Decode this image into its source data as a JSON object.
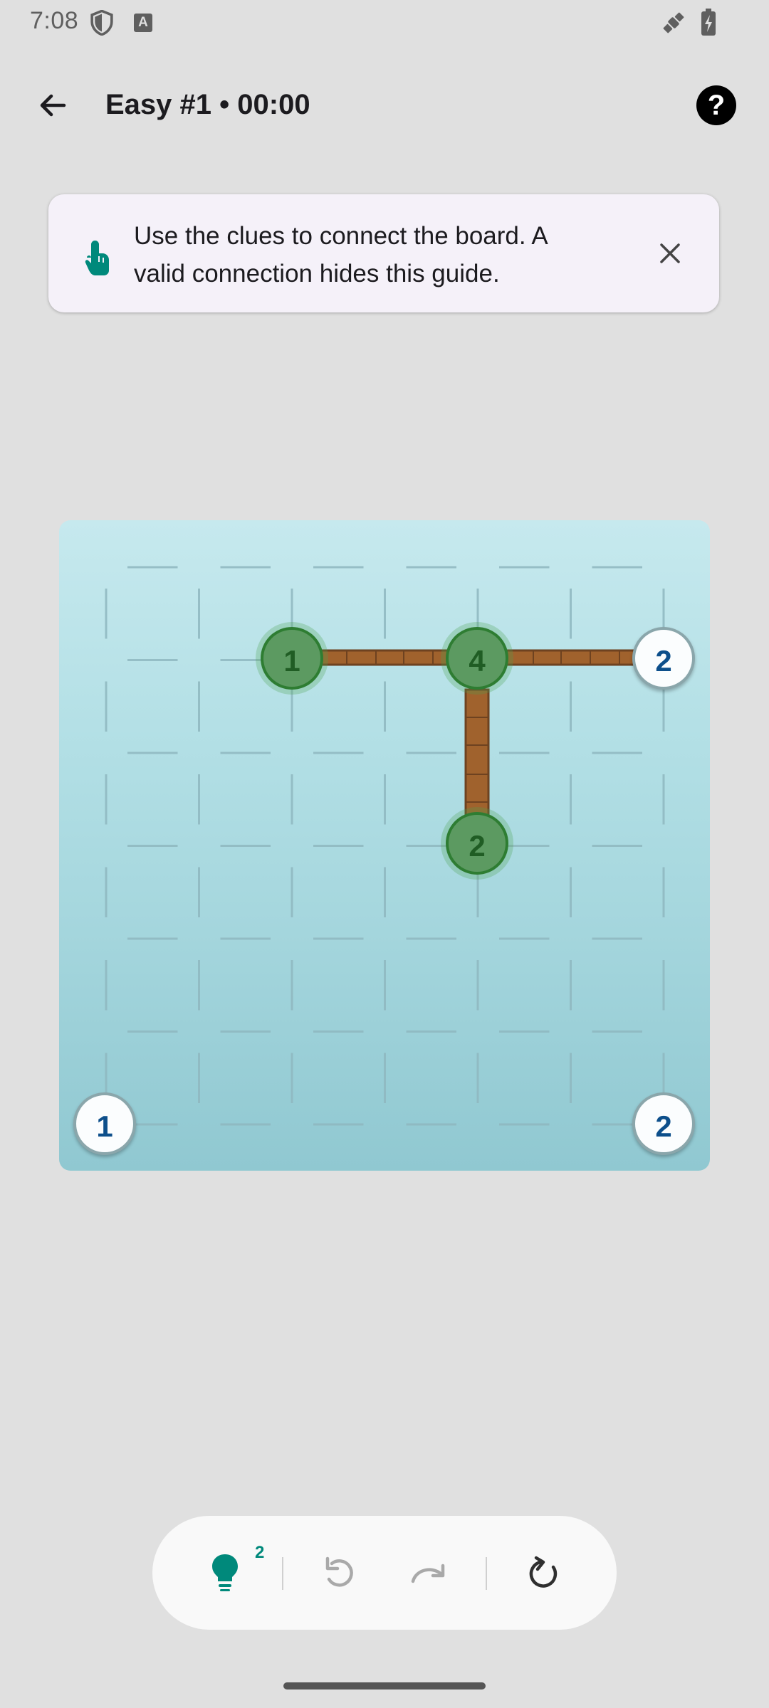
{
  "status_bar": {
    "time": "7:08",
    "a_badge": "A"
  },
  "app_bar": {
    "title": "Easy #1 • 00:00",
    "help_label": "?"
  },
  "guide": {
    "text": "Use the clues to connect the board. A valid connection hides this guide."
  },
  "board": {
    "grid_size": 7,
    "nodes": [
      {
        "label": "1",
        "state": "done"
      },
      {
        "label": "4",
        "state": "done"
      },
      {
        "label": "2",
        "state": "pending"
      },
      {
        "label": "2",
        "state": "done"
      },
      {
        "label": "1",
        "state": "pending"
      },
      {
        "label": "2",
        "state": "pending"
      }
    ]
  },
  "toolbar": {
    "hint_count": "2",
    "hint_icon": "lightbulb-icon",
    "undo_icon": "undo-icon",
    "redo_icon": "redo-icon",
    "reset_icon": "reset-icon"
  },
  "colors": {
    "accent": "#00897b",
    "bridge": "#a0622d",
    "solved_node": "#5c9a61",
    "clue_text": "#0d4f8b"
  }
}
